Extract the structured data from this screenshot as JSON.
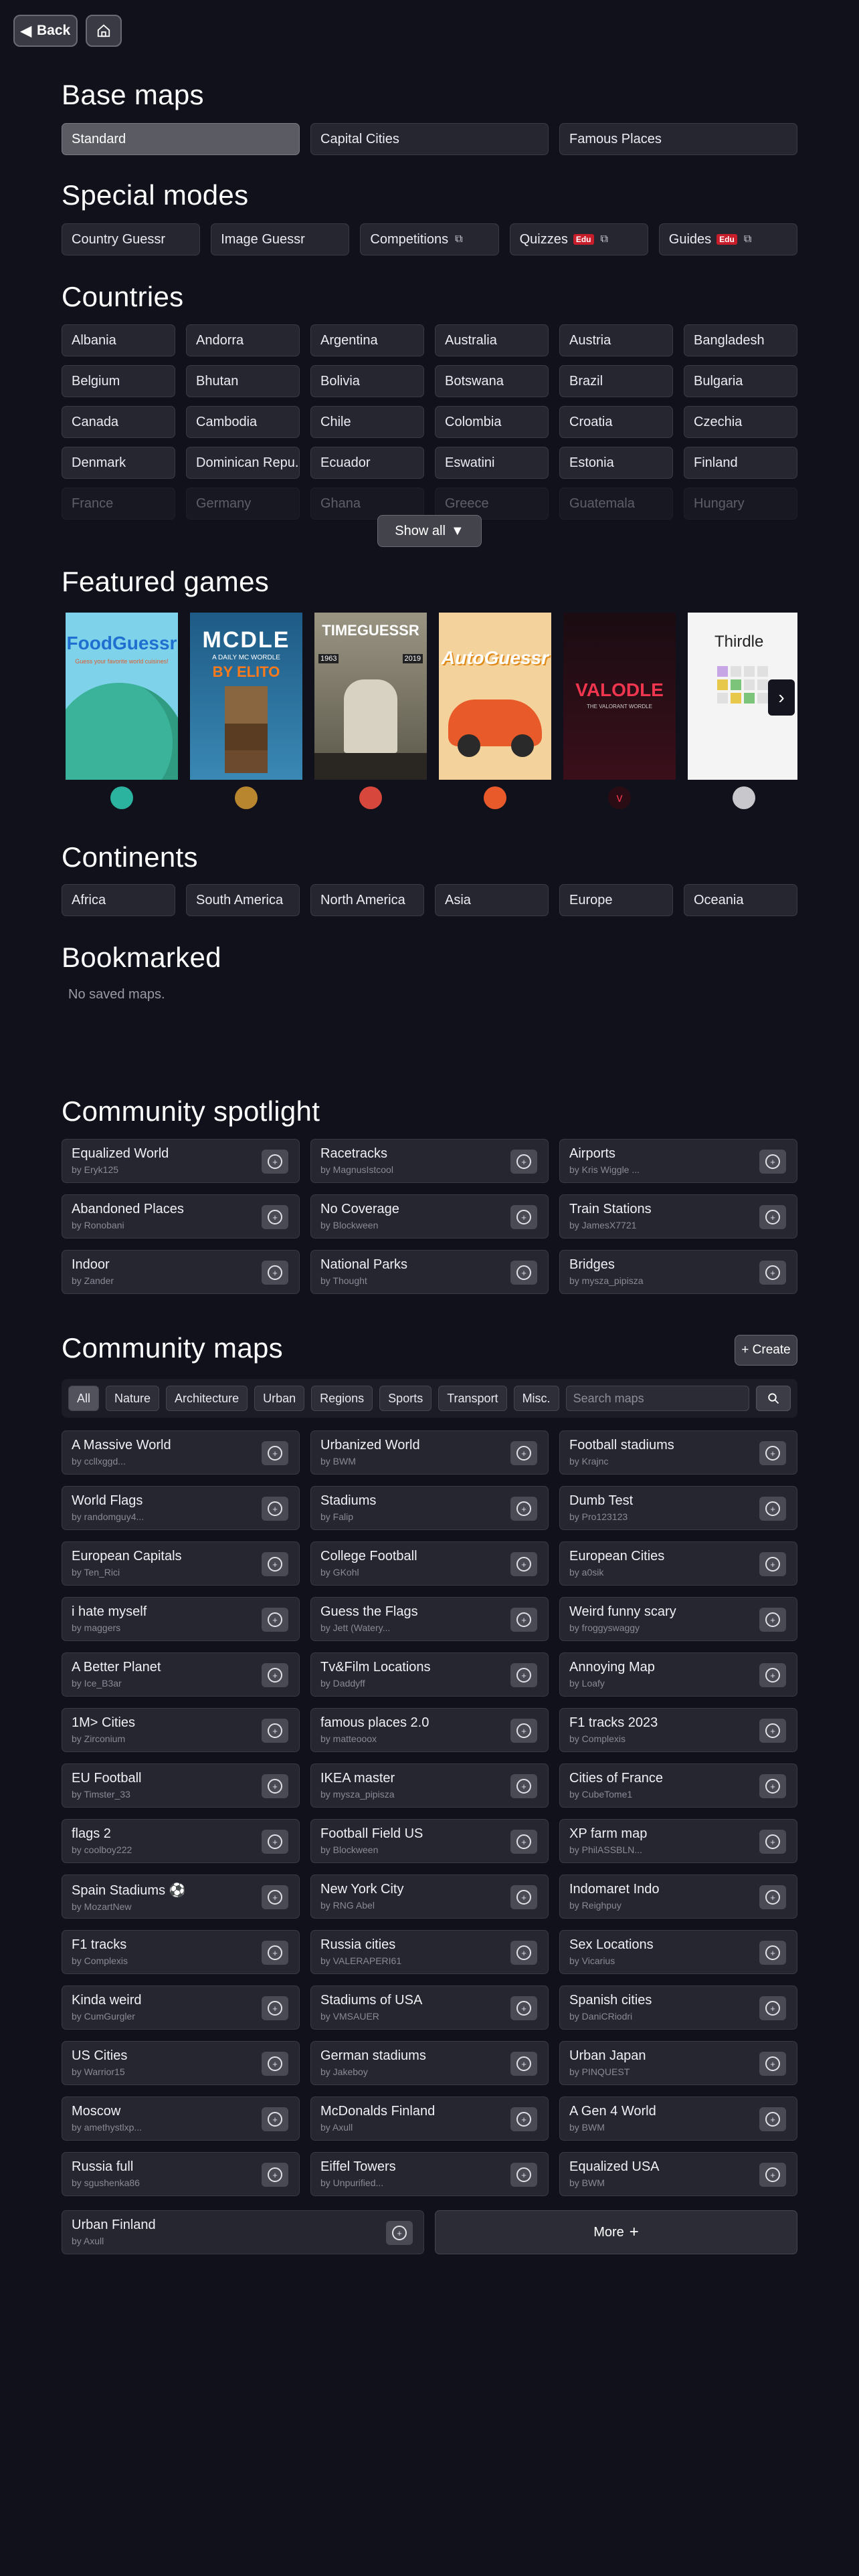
{
  "nav": {
    "back_label": "Back"
  },
  "base_maps": {
    "title": "Base maps",
    "items": [
      "Standard",
      "Capital Cities",
      "Famous Places"
    ]
  },
  "special_modes": {
    "title": "Special modes",
    "items": [
      {
        "label": "Country Guessr",
        "external": false,
        "edu": ""
      },
      {
        "label": "Image Guessr",
        "external": false,
        "edu": ""
      },
      {
        "label": "Competitions",
        "external": true,
        "edu": ""
      },
      {
        "label": "Quizzes",
        "external": true,
        "edu": "Edu"
      },
      {
        "label": "Guides",
        "external": true,
        "edu": "Edu"
      }
    ]
  },
  "countries": {
    "title": "Countries",
    "items": [
      "Albania",
      "Andorra",
      "Argentina",
      "Australia",
      "Austria",
      "Bangladesh",
      "Belgium",
      "Bhutan",
      "Bolivia",
      "Botswana",
      "Brazil",
      "Bulgaria",
      "Canada",
      "Cambodia",
      "Chile",
      "Colombia",
      "Croatia",
      "Czechia",
      "Denmark",
      "Dominican Repu...",
      "Ecuador",
      "Eswatini",
      "Estonia",
      "Finland"
    ],
    "faded_items": [
      "France",
      "Germany",
      "Ghana",
      "Greece",
      "Guatemala",
      "Hungary"
    ],
    "show_all_label": "Show all"
  },
  "featured": {
    "title": "Featured games",
    "games": [
      {
        "name": "FoodGuessr",
        "subtitle": "Guess your favorite world cuisines!",
        "bg": "#6fd0e8",
        "icon_color": "#2bb3a0"
      },
      {
        "name": "MCDLE",
        "subtitle": "A DAILY MC WORDLE",
        "extra": "BY ELITO",
        "bg": "#2d6e9e",
        "icon_color": "#b8862f"
      },
      {
        "name": "TIMEGUESSR",
        "year_left": "1963",
        "year_right": "2019",
        "bg": "#8a8574",
        "icon_color": "#d8473b"
      },
      {
        "name": "AutoGuessr",
        "bg": "#f1d29a",
        "icon_color": "#e85a2a"
      },
      {
        "name": "VALODLE",
        "subtitle": "THE VALORANT WORDLE",
        "bg": "#1c0f15",
        "icon_color": "#e8304a"
      },
      {
        "name": "Thirdle",
        "bg": "#f4f4f4",
        "icon_color": "#c7c7cc"
      }
    ]
  },
  "continents": {
    "title": "Continents",
    "items": [
      "Africa",
      "South America",
      "North America",
      "Asia",
      "Europe",
      "Oceania"
    ]
  },
  "bookmarked": {
    "title": "Bookmarked",
    "empty_text": "No saved maps."
  },
  "spotlight": {
    "title": "Community spotlight",
    "maps": [
      {
        "title": "Equalized World",
        "author": "by Eryk125"
      },
      {
        "title": "Racetracks",
        "author": "by MagnusIstcool"
      },
      {
        "title": "Airports",
        "author": "by Kris Wiggle ..."
      },
      {
        "title": "Abandoned Places",
        "author": "by Ronobani"
      },
      {
        "title": "No Coverage",
        "author": "by Blockween"
      },
      {
        "title": "Train Stations",
        "author": "by JamesX7721"
      },
      {
        "title": "Indoor",
        "author": "by Zander"
      },
      {
        "title": "National Parks",
        "author": "by Thought"
      },
      {
        "title": "Bridges",
        "author": "by mysza_pipisza"
      }
    ]
  },
  "community": {
    "title": "Community maps",
    "create_label": "+ Create",
    "filters": [
      "All",
      "Nature",
      "Architecture",
      "Urban",
      "Regions",
      "Sports",
      "Transport",
      "Misc."
    ],
    "search_placeholder": "Search maps",
    "maps": [
      {
        "title": "A Massive World",
        "author": "by ccllxggd..."
      },
      {
        "title": "Urbanized World",
        "author": "by BWM"
      },
      {
        "title": "Football stadiums",
        "author": "by Krajnc"
      },
      {
        "title": "World Flags",
        "author": "by randomguy4..."
      },
      {
        "title": "Stadiums",
        "author": "by Falip"
      },
      {
        "title": "Dumb Test",
        "author": "by Pro123123"
      },
      {
        "title": "European Capitals",
        "author": "by Ten_Rici"
      },
      {
        "title": "College Football",
        "author": "by GKohl"
      },
      {
        "title": "European Cities",
        "author": "by a0sik"
      },
      {
        "title": "i hate myself",
        "author": "by maggers"
      },
      {
        "title": "Guess the Flags",
        "author": "by Jett (Watery..."
      },
      {
        "title": "Weird funny scary",
        "author": "by froggyswaggy"
      },
      {
        "title": "A Better Planet",
        "author": "by Ice_B3ar"
      },
      {
        "title": "Tv&Film Locations",
        "author": "by Daddyff"
      },
      {
        "title": "Annoying Map",
        "author": "by Loafy"
      },
      {
        "title": "1M> Cities",
        "author": "by Zirconium"
      },
      {
        "title": "famous places 2.0",
        "author": "by matteooox"
      },
      {
        "title": "F1 tracks 2023",
        "author": "by Complexis"
      },
      {
        "title": "EU Football",
        "author": "by Timster_33"
      },
      {
        "title": "IKEA master",
        "author": "by mysza_pipisza"
      },
      {
        "title": "Cities of France",
        "author": "by CubeTome1"
      },
      {
        "title": "flags 2",
        "author": "by coolboy222"
      },
      {
        "title": "Football Field US",
        "author": "by Blockween"
      },
      {
        "title": "XP farm map",
        "author": "by PhilASSBLN..."
      },
      {
        "title": "Spain Stadiums ⚽",
        "author": "by MozartNew"
      },
      {
        "title": "New York City",
        "author": "by RNG Abel"
      },
      {
        "title": "Indomaret Indo",
        "author": "by Reighpuy"
      },
      {
        "title": "F1 tracks",
        "author": "by Complexis"
      },
      {
        "title": "Russia cities",
        "author": "by VALERAPERI61"
      },
      {
        "title": "Sex Locations",
        "author": "by Vicarius"
      },
      {
        "title": "Kinda weird",
        "author": "by CumGurgler"
      },
      {
        "title": "Stadiums of USA",
        "author": "by VMSAUER"
      },
      {
        "title": "Spanish cities",
        "author": "by DaniCRiodri"
      },
      {
        "title": "US Cities",
        "author": "by Warrior15"
      },
      {
        "title": "German stadiums",
        "author": "by Jakeboy"
      },
      {
        "title": "Urban Japan",
        "author": "by PINQUEST"
      },
      {
        "title": "Moscow",
        "author": "by amethystlxp..."
      },
      {
        "title": "McDonalds Finland",
        "author": "by Axull"
      },
      {
        "title": "A Gen 4 World",
        "author": "by BWM"
      },
      {
        "title": "Russia full",
        "author": "by sgushenka86"
      },
      {
        "title": "Eiffel Towers",
        "author": "by Unpurified..."
      },
      {
        "title": "Equalized USA",
        "author": "by BWM"
      }
    ],
    "last_map": {
      "title": "Urban Finland",
      "author": "by Axull"
    },
    "more_label": "More"
  }
}
